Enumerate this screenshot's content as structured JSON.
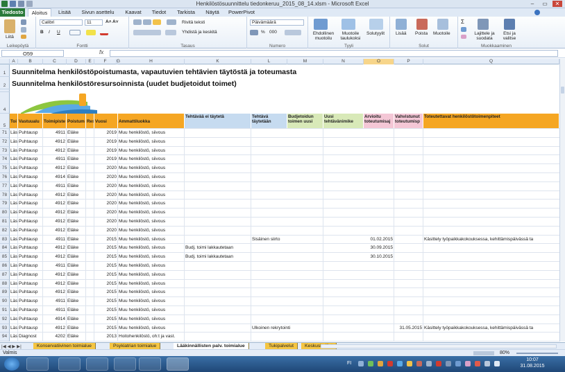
{
  "window": {
    "title": "Henkilöstösuunnittelu tiedonkeruu_2015_08_14.xlsm  -  Microsoft Excel",
    "minimize": "–",
    "maximize": "▭",
    "close": "✕"
  },
  "ribbon_tabs": [
    "Tiedosto",
    "Aloitus",
    "Lisää",
    "Sivun asettelu",
    "Kaavat",
    "Tiedot",
    "Tarkista",
    "Näytä",
    "PowerPivot"
  ],
  "ribbon": {
    "paste": "Liitä",
    "font_name": "Calibri",
    "font_size": "11",
    "bold": "B",
    "italic": "I",
    "underline": "U",
    "wrap_text": "Rivitä teksti",
    "merge": "Yhdistä ja keskitä",
    "number_format": "Päivämäärä",
    "percent": "%",
    "thousands": "000",
    "conditional": "Ehdollinen muotoilu",
    "format_table": "Muotoile taulukoksi",
    "cell_styles": "Solutyylit",
    "insert": "Lisää",
    "delete": "Poista",
    "format": "Muotoile",
    "sort": "Lajittele ja suodata",
    "find": "Etsi ja valitse",
    "groups": [
      "Leikepöytä",
      "Fontti",
      "Tasaus",
      "Numero",
      "Tyyli",
      "Solut",
      "Muokkaaminen"
    ]
  },
  "formula_bar": {
    "name_box": "O59",
    "fx": "fx",
    "value": ""
  },
  "columns": [
    {
      "label": "A"
    },
    {
      "label": "B"
    },
    {
      "label": "C"
    },
    {
      "label": "D"
    },
    {
      "label": "E"
    },
    {
      "label": "F"
    },
    {
      "label": "G"
    },
    {
      "label": "H"
    },
    {
      "label": "K"
    },
    {
      "label": "L"
    },
    {
      "label": "M"
    },
    {
      "label": "N"
    },
    {
      "label": "O"
    },
    {
      "label": "P"
    },
    {
      "label": "Q"
    }
  ],
  "sheet_title_1": "Suunnitelma henkilöstöpoistumasta, vapautuvien tehtävien täytöstä ja toteumasta",
  "sheet_title_2": "Suunnitelma henkilöstöresursoinnista (uudet budjetoidut toimet)",
  "header_row": {
    "num": "5",
    "a": "Toi",
    "b": "Vastuualu",
    "c": "Toimipiste",
    "d": "Poistum",
    "e": "Res",
    "f": "Vuosi",
    "h": "Ammattiluokka",
    "k": "Tehtävää ei täytetä",
    "l": "Tehtävä täytetään",
    "m": "Budjetoidun toimen uusi",
    "n": "Uusi tehtävänimike",
    "o": "Arvioitu toteutumisaj",
    "p": "Vahvistunut toteutumisp",
    "q": "Toteutettavat henkilöstötoimenpiteet"
  },
  "row_numbers_top": [
    "1",
    "2",
    "3",
    "4"
  ],
  "rows": [
    {
      "n": "71",
      "a": "Läs",
      "b": "Puhtausp",
      "c": "4911",
      "d": "Eläke",
      "f": "2019",
      "h": "Muu henkilöstö, siivous",
      "k": "",
      "l": "",
      "o": "",
      "p": "",
      "q": ""
    },
    {
      "n": "72",
      "a": "Läs",
      "b": "Puhtausp",
      "c": "4912",
      "d": "Eläke",
      "f": "2019",
      "h": "Muu henkilöstö, siivous",
      "k": "",
      "l": "",
      "o": "",
      "p": "",
      "q": ""
    },
    {
      "n": "73",
      "a": "Läs",
      "b": "Puhtausp",
      "c": "4912",
      "d": "Eläke",
      "f": "2019",
      "h": "Muu henkilöstö, siivous",
      "k": "",
      "l": "",
      "o": "",
      "p": "",
      "q": ""
    },
    {
      "n": "74",
      "a": "Läs",
      "b": "Puhtausp",
      "c": "4911",
      "d": "Eläke",
      "f": "2019",
      "h": "Muu henkilöstö, siivous",
      "k": "",
      "l": "",
      "o": "",
      "p": "",
      "q": ""
    },
    {
      "n": "75",
      "a": "Läs",
      "b": "Puhtausp",
      "c": "4912",
      "d": "Eläke",
      "f": "2020",
      "h": "Muu henkilöstö, siivous",
      "k": "",
      "l": "",
      "o": "",
      "p": "",
      "q": ""
    },
    {
      "n": "76",
      "a": "Läs",
      "b": "Puhtausp",
      "c": "4914",
      "d": "Eläke",
      "f": "2020",
      "h": "Muu henkilöstö, siivous",
      "k": "",
      "l": "",
      "o": "",
      "p": "",
      "q": ""
    },
    {
      "n": "77",
      "a": "Läs",
      "b": "Puhtausp",
      "c": "4911",
      "d": "Eläke",
      "f": "2020",
      "h": "Muu henkilöstö, siivous",
      "k": "",
      "l": "",
      "o": "",
      "p": "",
      "q": ""
    },
    {
      "n": "78",
      "a": "Läs",
      "b": "Puhtausp",
      "c": "4912",
      "d": "Eläke",
      "f": "2020",
      "h": "Muu henkilöstö, siivous",
      "k": "",
      "l": "",
      "o": "",
      "p": "",
      "q": ""
    },
    {
      "n": "79",
      "a": "Läs",
      "b": "Puhtausp",
      "c": "4912",
      "d": "Eläke",
      "f": "2020",
      "h": "Muu henkilöstö, siivous",
      "k": "",
      "l": "",
      "o": "",
      "p": "",
      "q": ""
    },
    {
      "n": "80",
      "a": "Läs",
      "b": "Puhtausp",
      "c": "4912",
      "d": "Eläke",
      "f": "2020",
      "h": "Muu henkilöstö, siivous",
      "k": "",
      "l": "",
      "o": "",
      "p": "",
      "q": ""
    },
    {
      "n": "81",
      "a": "Läs",
      "b": "Puhtausp",
      "c": "4912",
      "d": "Eläke",
      "f": "2020",
      "h": "Muu henkilöstö, siivous",
      "k": "",
      "l": "",
      "o": "",
      "p": "",
      "q": ""
    },
    {
      "n": "82",
      "a": "Läs",
      "b": "Puhtausp",
      "c": "4912",
      "d": "Eläke",
      "f": "2020",
      "h": "Muu henkilöstö, siivous",
      "k": "",
      "l": "",
      "o": "",
      "p": "",
      "q": ""
    },
    {
      "n": "83",
      "a": "Läs",
      "b": "Puhtausp",
      "c": "4911",
      "d": "Eläke",
      "f": "2015",
      "h": "Muu henkilöstö, siivous",
      "k": "",
      "l": "Sisäinen siirto",
      "o": "01.02.2015",
      "p": "",
      "q": "Käsittely työpaikkakokouksessa, kehittämispäivässä ta"
    },
    {
      "n": "84",
      "a": "Läs",
      "b": "Puhtausp",
      "c": "4912",
      "d": "Eläke",
      "f": "2015",
      "h": "Muu henkilöstö, siivous",
      "k": "Budj. toimi lakkautetaan",
      "l": "",
      "o": "30.09.2015",
      "p": "",
      "q": ""
    },
    {
      "n": "85",
      "a": "Läs",
      "b": "Puhtausp",
      "c": "4912",
      "d": "Eläke",
      "f": "2015",
      "h": "Muu henkilöstö, siivous",
      "k": "Budj. toimi lakkautetaan",
      "l": "",
      "o": "30.10.2015",
      "p": "",
      "q": ""
    },
    {
      "n": "86",
      "a": "Läs",
      "b": "Puhtausp",
      "c": "4911",
      "d": "Eläke",
      "f": "2015",
      "h": "Muu henkilöstö, siivous",
      "k": "",
      "l": "",
      "o": "",
      "p": "",
      "q": ""
    },
    {
      "n": "87",
      "a": "Läs",
      "b": "Puhtausp",
      "c": "4912",
      "d": "Eläke",
      "f": "2015",
      "h": "Muu henkilöstö, siivous",
      "k": "",
      "l": "",
      "o": "",
      "p": "",
      "q": ""
    },
    {
      "n": "88",
      "a": "Läs",
      "b": "Puhtausp",
      "c": "4912",
      "d": "Eläke",
      "f": "2015",
      "h": "Muu henkilöstö, siivous",
      "k": "",
      "l": "",
      "o": "",
      "p": "",
      "q": ""
    },
    {
      "n": "89",
      "a": "Läs",
      "b": "Puhtausp",
      "c": "4912",
      "d": "Eläke",
      "f": "2015",
      "h": "Muu henkilöstö, siivous",
      "k": "",
      "l": "",
      "o": "",
      "p": "",
      "q": ""
    },
    {
      "n": "90",
      "a": "Läs",
      "b": "Puhtausp",
      "c": "4911",
      "d": "Eläke",
      "f": "2015",
      "h": "Muu henkilöstö, siivous",
      "k": "",
      "l": "",
      "o": "",
      "p": "",
      "q": ""
    },
    {
      "n": "91",
      "a": "Läs",
      "b": "Puhtausp",
      "c": "4911",
      "d": "Eläke",
      "f": "2015",
      "h": "Muu henkilöstö, siivous",
      "k": "",
      "l": "",
      "o": "",
      "p": "",
      "q": ""
    },
    {
      "n": "92",
      "a": "Läs",
      "b": "Puhtausp",
      "c": "4914",
      "d": "Eläke",
      "f": "2015",
      "h": "Muu henkilöstö, siivous",
      "k": "",
      "l": "",
      "o": "",
      "p": "",
      "q": ""
    },
    {
      "n": "93",
      "a": "Läs",
      "b": "Puhtausp",
      "c": "4912",
      "d": "Eläke",
      "f": "2015",
      "h": "Muu henkilöstö, siivous",
      "k": "",
      "l": "Ulkoinen rekrytointi",
      "o": "",
      "p": "31.05.2015",
      "q": "Käsittely työpaikkakokouksessa, kehittämispäivässä ta"
    },
    {
      "n": "94",
      "a": "Läs",
      "b": "Diagnost",
      "c": "4202",
      "d": "Eläke",
      "f": "2013",
      "h": "Hoitohenkilöstö, oh:t ja vast.",
      "k": "",
      "l": "",
      "o": "",
      "p": "",
      "q": ""
    },
    {
      "n": "95",
      "a": "Läs",
      "b": "Diagnost",
      "c": "4202",
      "d": "Eläke",
      "f": "2013",
      "h": "Hoitohenkilöstö, oh:t ja vast.",
      "k": "",
      "l": "",
      "o": "",
      "p": "",
      "q": ""
    }
  ],
  "sheet_tabs": [
    "Konservatiivinen toimialue",
    "Psykiatrian toimialue",
    "Lääkinnällisten palv. toimialue",
    "Tukipalvelut",
    "Keskushallint"
  ],
  "active_sheet": "Lääkinnällisten palv. toimialue",
  "status": {
    "left": "Valmis",
    "zoom": "80%"
  },
  "taskbar": {
    "lang": "FI",
    "time": "10:07",
    "date": "31.08.2015"
  },
  "colors": {
    "header_orange": "#f5a623",
    "header_blue": "#c6dbf0",
    "header_green": "#d8e9b8",
    "header_pink": "#f4c7d6",
    "excel_green": "#2a7a3a"
  }
}
